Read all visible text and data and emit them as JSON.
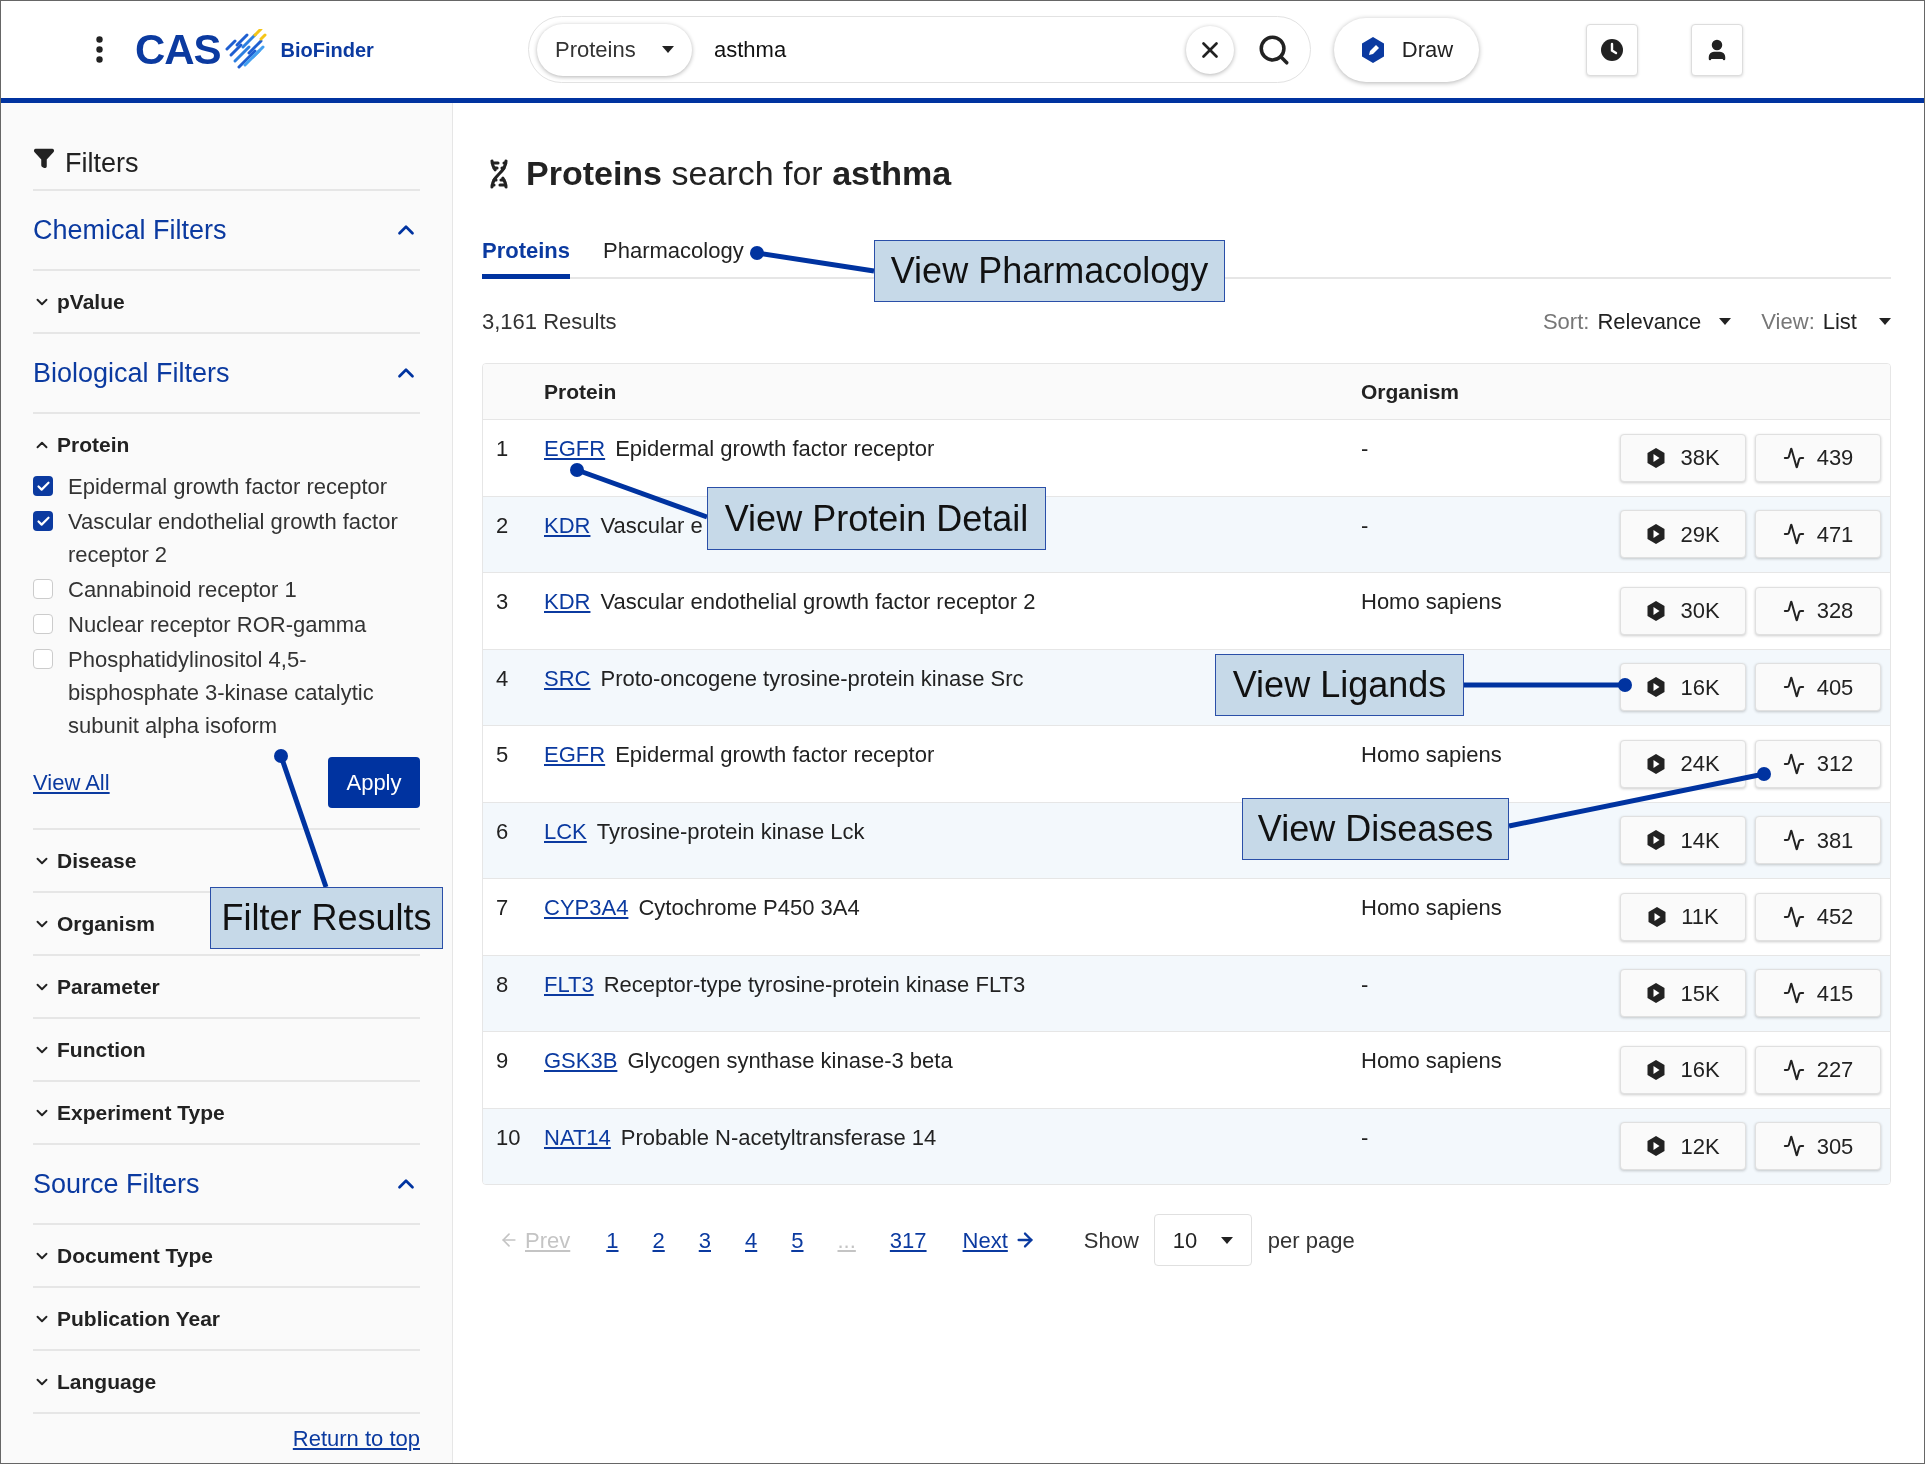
{
  "header": {
    "logo_text": "CAS",
    "product": "BioFinder",
    "search_category": "Proteins",
    "search_query": "asthma",
    "draw_button": "Draw"
  },
  "sidebar": {
    "title": "Filters",
    "sections": [
      {
        "kind": "group",
        "label": "Chemical Filters",
        "expanded": true
      },
      {
        "kind": "facet",
        "label": "pValue",
        "expanded": false
      },
      {
        "kind": "group",
        "label": "Biological Filters",
        "expanded": true
      },
      {
        "kind": "facet",
        "label": "Protein",
        "expanded": true,
        "options": [
          {
            "label": "Epidermal growth factor receptor",
            "checked": true
          },
          {
            "label": "Vascular endothelial growth factor receptor 2",
            "checked": true
          },
          {
            "label": "Cannabinoid receptor 1",
            "checked": false
          },
          {
            "label": "Nuclear receptor ROR-gamma",
            "checked": false
          },
          {
            "label": "Phosphatidylinositol 4,5-bisphosphate 3-kinase catalytic subunit alpha isoform",
            "checked": false
          }
        ],
        "view_all": "View All",
        "apply": "Apply"
      },
      {
        "kind": "facet",
        "label": "Disease",
        "expanded": false
      },
      {
        "kind": "facet",
        "label": "Organism",
        "expanded": false
      },
      {
        "kind": "facet",
        "label": "Parameter",
        "expanded": false
      },
      {
        "kind": "facet",
        "label": "Function",
        "expanded": false
      },
      {
        "kind": "facet",
        "label": "Experiment Type",
        "expanded": false
      },
      {
        "kind": "group",
        "label": "Source Filters",
        "expanded": true
      },
      {
        "kind": "facet",
        "label": "Document Type",
        "expanded": false
      },
      {
        "kind": "facet",
        "label": "Publication Year",
        "expanded": false
      },
      {
        "kind": "facet",
        "label": "Language",
        "expanded": false
      }
    ],
    "return_to_top": "Return to top"
  },
  "page_title": "**Proteins** search for  **asthma**",
  "tabs": [
    {
      "label": "Proteins",
      "selected": true
    },
    {
      "label": "Pharmacology",
      "selected": false
    }
  ],
  "results_count": "3,161 Results",
  "sort": {
    "label": "Sort:",
    "value": "Relevance"
  },
  "view": {
    "label": "View:",
    "value": "List"
  },
  "table": {
    "columns": [
      "Protein",
      "Organism"
    ],
    "rows": [
      {
        "index": "1",
        "symbol": "EGFR",
        "name": "Epidermal growth factor receptor",
        "organism": "-",
        "ligands": "38K",
        "diseases": "439"
      },
      {
        "index": "2",
        "symbol": "KDR",
        "name": "Vascular e",
        "organism": "-",
        "ligands": "29K",
        "diseases": "471"
      },
      {
        "index": "3",
        "symbol": "KDR",
        "name": "Vascular endothelial growth factor receptor 2",
        "organism": "Homo sapiens",
        "ligands": "30K",
        "diseases": "328"
      },
      {
        "index": "4",
        "symbol": "SRC",
        "name": "Proto-oncogene tyrosine-protein kinase Src",
        "ligands": "16K",
        "diseases": "405"
      },
      {
        "index": "5",
        "symbol": "EGFR",
        "name": "Epidermal growth factor receptor",
        "organism": "Homo sapiens",
        "ligands": "24K",
        "diseases": "312"
      },
      {
        "index": "6",
        "symbol": "LCK",
        "name": "Tyrosine-protein kinase Lck",
        "ligands": "14K",
        "diseases": "381"
      },
      {
        "index": "7",
        "symbol": "CYP3A4",
        "name": "Cytochrome P450 3A4",
        "organism": "Homo sapiens",
        "ligands": "11K",
        "diseases": "452"
      },
      {
        "index": "8",
        "symbol": "FLT3",
        "name": "Receptor-type tyrosine-protein kinase FLT3",
        "organism": "-",
        "ligands": "15K",
        "diseases": "415"
      },
      {
        "index": "9",
        "symbol": "GSK3B",
        "name": "Glycogen synthase kinase-3 beta",
        "organism": "Homo sapiens",
        "ligands": "16K",
        "diseases": "227"
      },
      {
        "index": "10",
        "symbol": "NAT14",
        "name": "Probable N-acetyltransferase 14",
        "organism": "-",
        "ligands": "12K",
        "diseases": "305"
      }
    ]
  },
  "pagination": {
    "prev": {
      "label": "Prev",
      "disabled": true
    },
    "pages": [
      {
        "kind": "page",
        "label": "1"
      },
      {
        "kind": "page",
        "label": "2"
      },
      {
        "kind": "page",
        "label": "3"
      },
      {
        "kind": "page",
        "label": "4"
      },
      {
        "kind": "page",
        "label": "5"
      },
      {
        "kind": "ellipsis",
        "label": "..."
      },
      {
        "kind": "page",
        "label": "317"
      }
    ],
    "next": {
      "label": "Next",
      "disabled": false
    },
    "show_label": "Show",
    "per_page": "10",
    "per_page_suffix": "per page"
  },
  "callouts": [
    {
      "text": "View Pharmacology"
    },
    {
      "text": "View Protein Detail"
    },
    {
      "text": "Filter Results"
    },
    {
      "text": "View Ligands"
    },
    {
      "text": "View Diseases"
    }
  ]
}
